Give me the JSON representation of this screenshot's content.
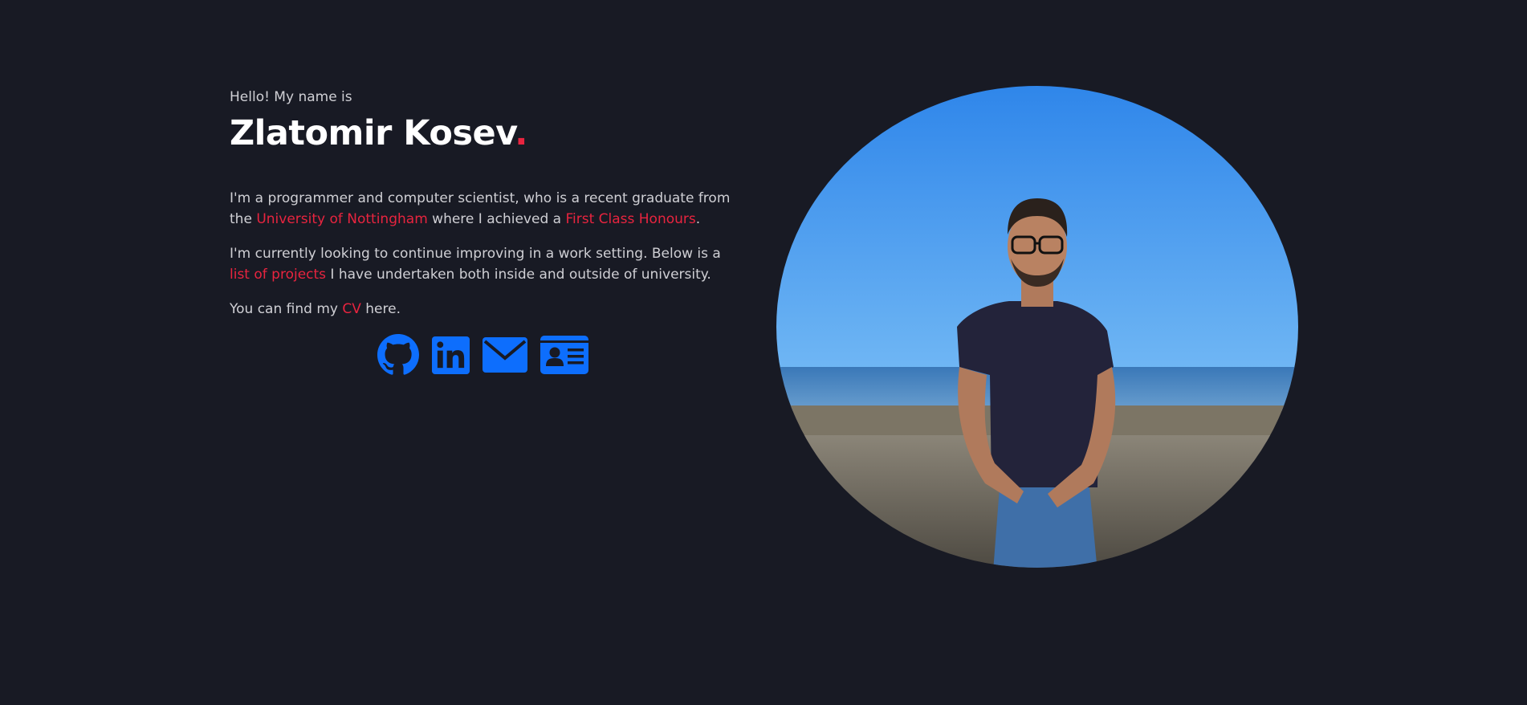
{
  "hero": {
    "greeting": "Hello! My name is",
    "name": "Zlatomir Kosev",
    "name_dot": "."
  },
  "bio": {
    "p1_a": "I'm a programmer and computer scientist, who is a recent graduate from the ",
    "p1_link1": "University of Nottingham",
    "p1_b": " where I achieved a ",
    "p1_link2": "First Class Honours",
    "p1_c": ".",
    "p2_a": "I'm currently looking to continue improving in a work setting. Below is a ",
    "p2_link": "list of projects",
    "p2_b": " I have undertaken both inside and outside of university.",
    "p3_a": "You can find my ",
    "p3_link": "CV",
    "p3_b": " here."
  },
  "socials": [
    {
      "icon": "github-icon"
    },
    {
      "icon": "linkedin-icon"
    },
    {
      "icon": "mail-icon"
    },
    {
      "icon": "contact-card-icon"
    }
  ],
  "colors": {
    "background": "#181a24",
    "accent": "#e8243f",
    "icon": "#0d6efd",
    "heading": "#ffffff",
    "text": "#cfcfd4"
  }
}
